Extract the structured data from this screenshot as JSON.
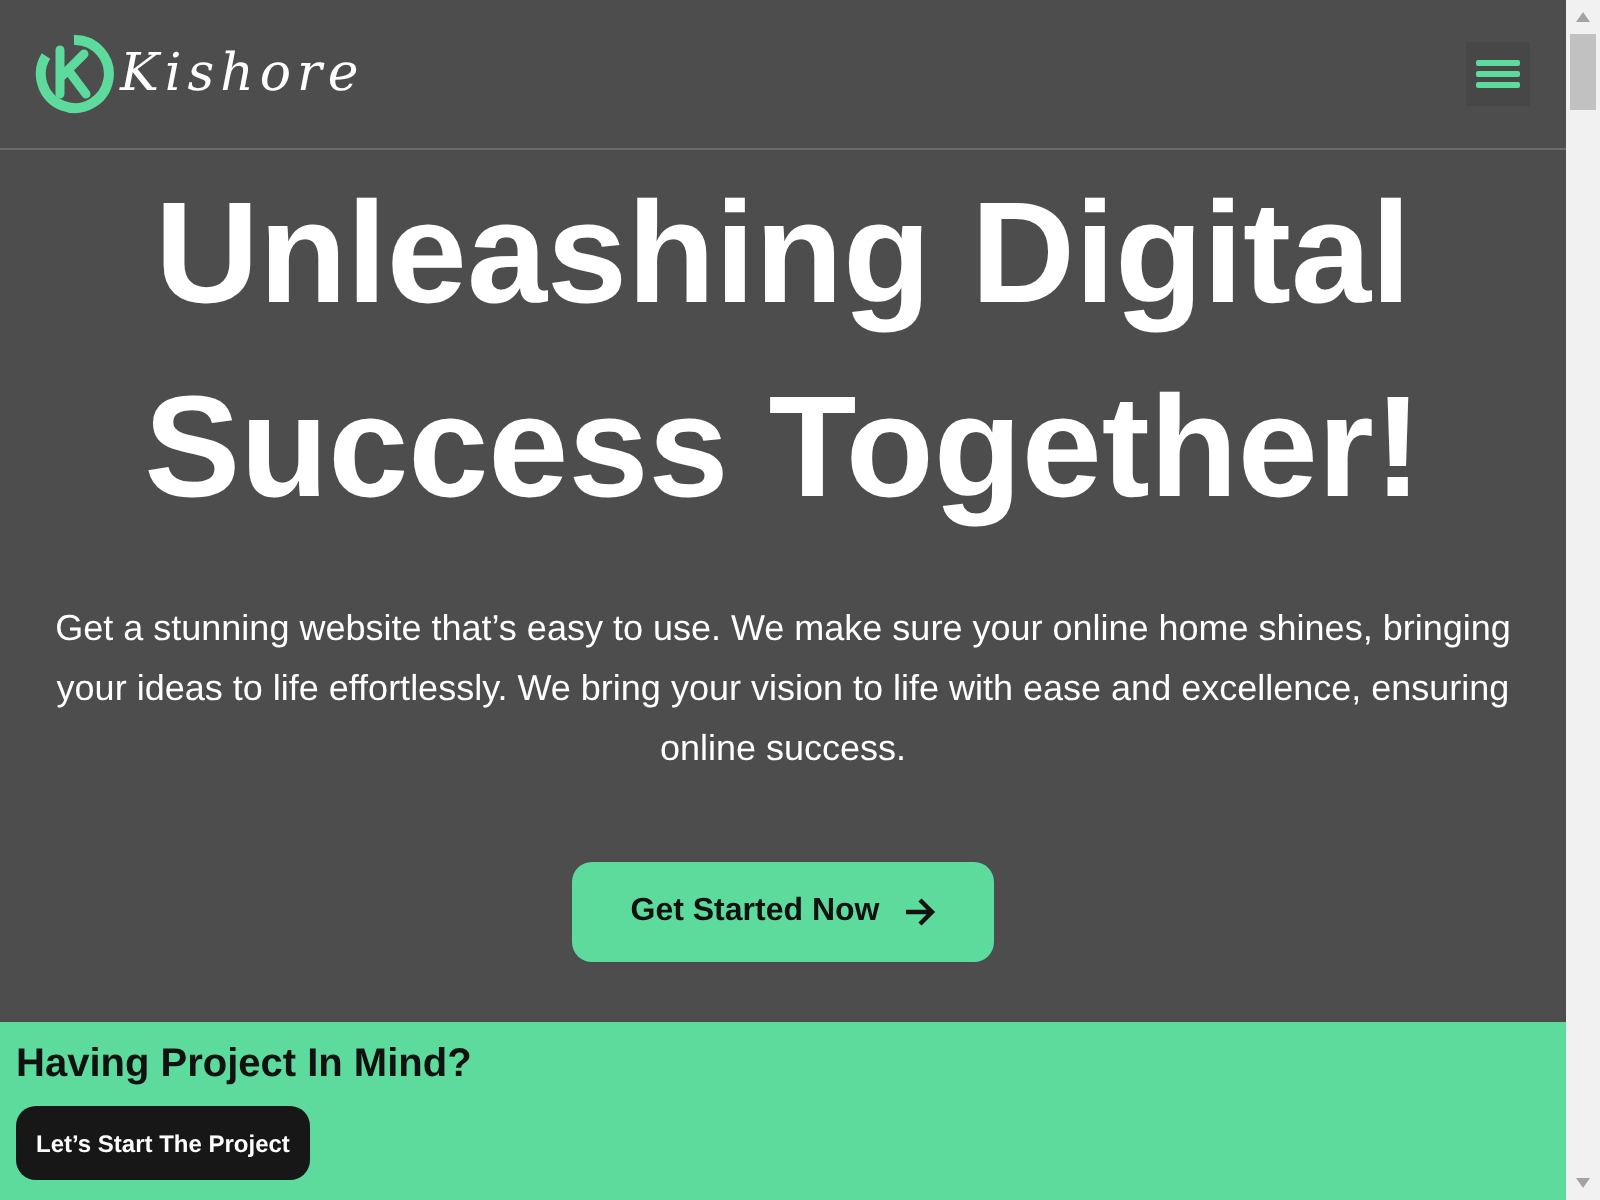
{
  "header": {
    "logo_text": "Kishore"
  },
  "hero": {
    "title": "Unleashing Digital Success Together!",
    "description": "Get a stunning website that’s easy to use. We make sure your online home shines, bringing your ideas to life effortlessly. We bring your vision to life with ease and excellence, ensuring online success.",
    "button": "Get Started Now"
  },
  "cta": {
    "heading": "Having Project In Mind?",
    "button": "Let’s Start The Project"
  }
}
